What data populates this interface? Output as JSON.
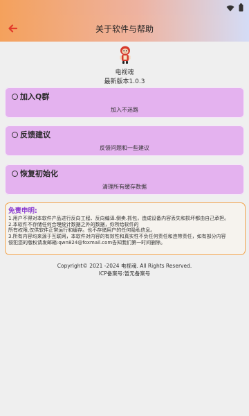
{
  "header": {
    "title": "关于软件与帮助"
  },
  "app": {
    "name": "电视魂",
    "version": "最新版本1.0.3"
  },
  "cards": [
    {
      "title": "加入Q群",
      "subtitle": "加入不迷路"
    },
    {
      "title": "反馈建议",
      "subtitle": "反馈问题和一些建议"
    },
    {
      "title": "恢复初始化",
      "subtitle": "清理所有缓存数据"
    }
  ],
  "disclaimer": {
    "title": "免责申明:",
    "lines": [
      "1.用户不得对本软件产品进行反向工程、反向编译.倒卖.抓包，造成设备内容丢失和损坏都由自己承担。",
      "2.本软件不存储任何合理统计数据之外的数据，你所给软件的",
      "所有权限,仅供软件正常运行和缓存。也不存储用户的任何隐私信息。",
      "3.所有内容均来源于互联网，本软件对内容的有效性和真实性不负任何责任和连带责任，如有部分内容",
      "侵犯您的版权请发邮箱:qwn824@foxmail.com告知我们第一时间删除。"
    ]
  },
  "footer": {
    "copyright": "Copyright© 2021 -2024 电视魂. All Rights Reserved.",
    "icp": "ICP备案号:暂无备案号"
  },
  "colors": {
    "accent_orange": "#f4a15c",
    "card_purple": "#e4b2ef",
    "disclaimer_border": "#f2a24a",
    "disclaimer_title": "#8a3ad0"
  },
  "icons": [
    "wifi-icon",
    "battery-icon",
    "back-arrow-icon",
    "app-logo-icon"
  ]
}
